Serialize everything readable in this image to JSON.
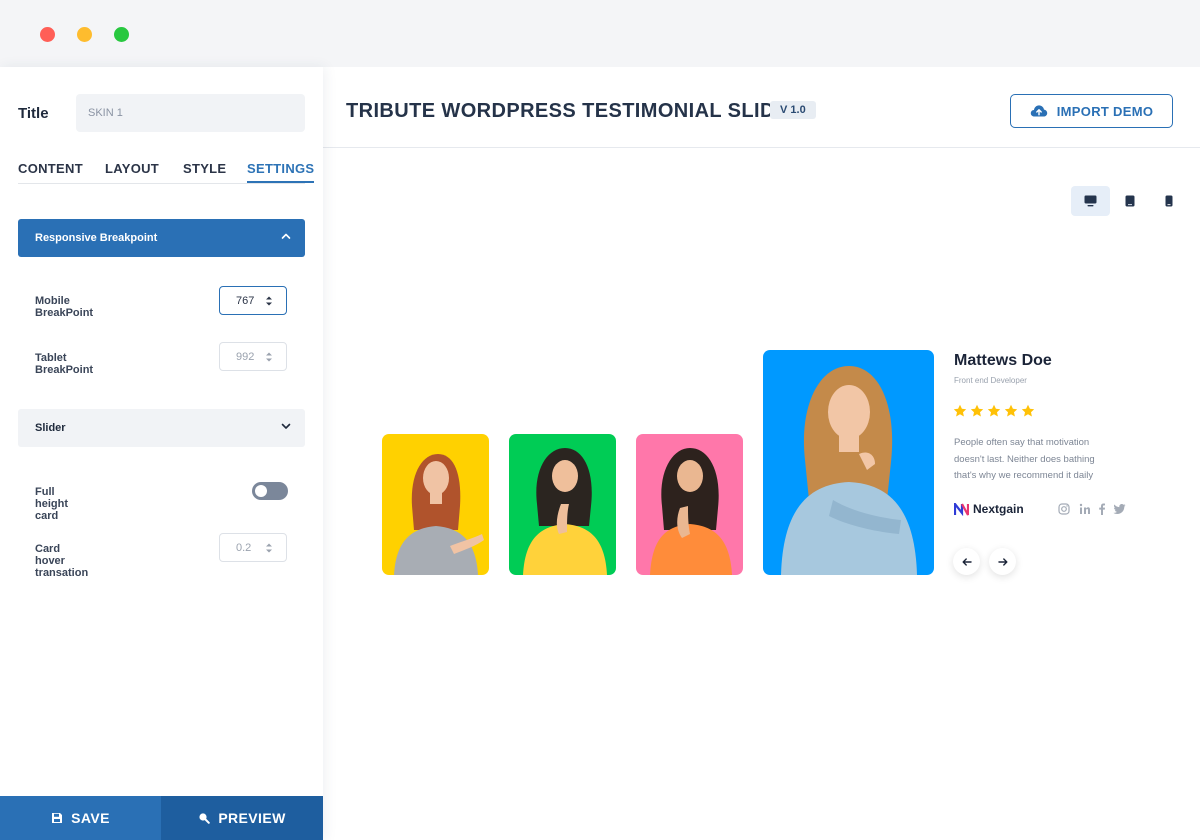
{
  "window": {
    "controls": [
      "close",
      "minimize",
      "maximize"
    ]
  },
  "sidebar": {
    "title_label": "Title",
    "title_value": "SKIN 1",
    "tabs": [
      {
        "label": "CONTENT",
        "active": false
      },
      {
        "label": "LAYOUT",
        "active": false
      },
      {
        "label": "STYLE",
        "active": false
      },
      {
        "label": "SETTINGS",
        "active": true
      }
    ],
    "responsive": {
      "header": "Responsive Breakpoint",
      "expanded": true,
      "mobile_label": "Mobile BreakPoint",
      "mobile_value": "767",
      "tablet_label": "Tablet BreakPoint",
      "tablet_value": "992"
    },
    "slider": {
      "header": "Slider",
      "expanded": false,
      "full_height_label": "Full height card",
      "full_height_on": false,
      "hover_label": "Card hover transation",
      "hover_value": "0.2"
    },
    "save_label": "SAVE",
    "preview_label": "PREVIEW"
  },
  "header": {
    "title": "TRIBUTE WORDPRESS TESTIMONIAL SLIDER",
    "version": "V 1.0",
    "import_label": "IMPORT DEMO"
  },
  "devices": [
    {
      "icon": "desktop-icon",
      "active": true
    },
    {
      "icon": "tablet-icon",
      "active": false
    },
    {
      "icon": "mobile-icon",
      "active": false
    }
  ],
  "slider": {
    "cards": [
      {
        "bg": "#ffd100"
      },
      {
        "bg": "#00cc55"
      },
      {
        "bg": "#ff77aa"
      },
      {
        "bg": "#0099ff"
      }
    ],
    "active": {
      "name": "Mattews Doe",
      "role": "Front end Developer",
      "rating": 5,
      "quote_lines": [
        "People often say that motivation",
        "doesn't last. Neither does bathing",
        "that's why we recommend it daily"
      ],
      "brand": "Nextgain",
      "social_icons": [
        "instagram-icon",
        "linkedin-icon",
        "facebook-icon",
        "twitter-icon"
      ]
    }
  },
  "colors": {
    "primary": "#2a70b5",
    "primary_dark": "#1e5e9f",
    "star": "#ffc107"
  }
}
